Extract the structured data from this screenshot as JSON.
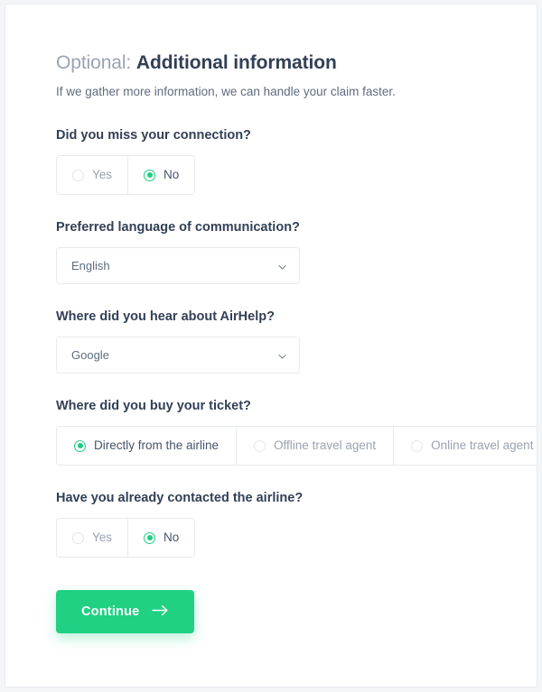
{
  "page": {
    "title_prefix": "Optional:",
    "title_strong": "Additional information",
    "subtitle": "If we gather more information, we can handle your claim faster."
  },
  "colors": {
    "accent_green": "#20d183",
    "radio_green": "#1ecd83",
    "heading_dark": "#323f56",
    "muted_text": "#9aa3b0",
    "body_text": "#5f6b7f",
    "border": "#e7eaee",
    "card_background": "#ffffff",
    "page_background": "#f4f5f7"
  },
  "fields": [
    {
      "id": "missed-connection",
      "label": "Did you miss your connection?",
      "type": "radio",
      "options": [
        {
          "label": "Yes",
          "selected": false
        },
        {
          "label": "No",
          "selected": true
        }
      ]
    },
    {
      "id": "preferred-language",
      "label": "Preferred language of communication?",
      "type": "select",
      "value": "English",
      "icon": "chevron-down-icon"
    },
    {
      "id": "hear-about-airhelp",
      "label": "Where did you hear about AirHelp?",
      "type": "select",
      "value": "Google",
      "icon": "chevron-down-icon"
    },
    {
      "id": "ticket-purchase",
      "label": "Where did you buy your ticket?",
      "type": "radio",
      "options": [
        {
          "label": "Directly from the airline",
          "selected": true
        },
        {
          "label": "Offline travel agent",
          "selected": false
        },
        {
          "label": "Online travel agent",
          "selected": false
        }
      ]
    },
    {
      "id": "contacted-airline",
      "label": "Have you already contacted the airline?",
      "type": "radio",
      "options": [
        {
          "label": "Yes",
          "selected": false
        },
        {
          "label": "No",
          "selected": true
        }
      ]
    }
  ],
  "submit": {
    "label": "Continue",
    "icon": "arrow-right-icon"
  }
}
